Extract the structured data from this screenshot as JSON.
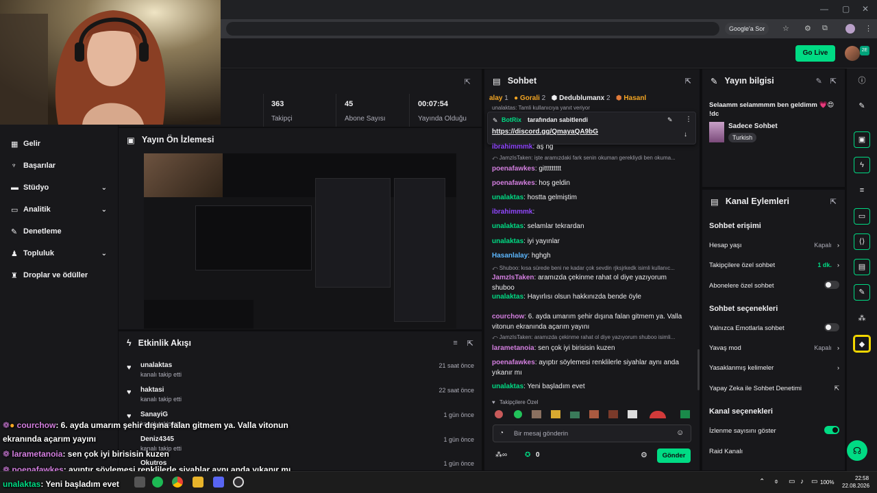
{
  "browser": {
    "google_sor": "Google'a Sor"
  },
  "topnav": {
    "go_live": "Go Live",
    "badge": "2E"
  },
  "leftnav": {
    "items": [
      {
        "label": "Gelir"
      },
      {
        "label": "Başarılar"
      },
      {
        "label": "Stüdyo"
      },
      {
        "label": "Analitik"
      },
      {
        "label": "Denetleme"
      },
      {
        "label": "Topluluk"
      },
      {
        "label": "Droplar ve ödüller"
      }
    ]
  },
  "stats": [
    {
      "value": "363",
      "label": "Takipçi"
    },
    {
      "value": "45",
      "label": "Abone Sayısı"
    },
    {
      "value": "00:07:54",
      "label": "Yayında Olduğu Süre"
    }
  ],
  "preview": {
    "title": "Yayın Ön İzlemesi"
  },
  "activity": {
    "title": "Etkinlik Akışı",
    "items": [
      {
        "name": "unalaktas",
        "sub": "kanalı takip etti",
        "time": "21 saat önce"
      },
      {
        "name": "haktasi",
        "sub": "kanalı takip etti",
        "time": "22 saat önce"
      },
      {
        "name": "SanayiG",
        "sub": "kanalı takip etti",
        "time": "1 gün önce"
      },
      {
        "name": "Deniz4345",
        "sub": "kanalı takip etti",
        "time": "1 gün önce"
      },
      {
        "name": "Okutros",
        "sub": "",
        "time": "1 gün önce"
      }
    ]
  },
  "chat": {
    "title": "Sohbet",
    "tabs": [
      {
        "name": "alay",
        "count": "1"
      },
      {
        "name": "Gorali",
        "count": "2"
      },
      {
        "name": "Dedublumanx",
        "count": "2"
      },
      {
        "name": "Hasanl",
        "count": ""
      }
    ],
    "top_reply": "unalaktas: Tamli kullanıcıya yanıt veriyor",
    "pinned_by": "BotRix",
    "pinned_suffix": "tarafından sabitlendi",
    "pinned_link": "https://discord.gg/QmayaQA9bG",
    "messages": [
      {
        "user": "ibrahimmmk",
        "text": ": aş ng",
        "color": "#9147ff"
      },
      {
        "reply": "JamzIsTaken: işte aramızdaki fark senin okuman gerekliydi ben okuma..."
      },
      {
        "user": "poenafawkes",
        "text": ": gittttttttt",
        "color": "#d47fe0"
      },
      {
        "user": "poenafawkes",
        "text": ": hoş geldin",
        "color": "#d47fe0"
      },
      {
        "user": "unalaktas",
        "text": ": hostta gelmiştim",
        "color": "#00db84"
      },
      {
        "user": "ibrahimmmk",
        "text": ":",
        "color": "#9147ff"
      },
      {
        "user": "unalaktas",
        "text": ": selamlar tekrardan",
        "color": "#00db84"
      },
      {
        "user": "unalaktas",
        "text": ": iyi yayınlar",
        "color": "#00db84"
      },
      {
        "user": "Hasanlalay",
        "text": ": hghgh",
        "color": "#5cb7ff"
      },
      {
        "reply": "Shuboo: kısa sürede beni ne kadar çok sevdin rjksjrkedk isimli kullanıc..."
      },
      {
        "user": "JamzIsTaken",
        "text": ": aramızda çekinme rahat ol diye yazıyorum shuboo",
        "color": "#d47fe0"
      },
      {
        "user": "unalaktas",
        "text": ": Hayırlısı olsun hakkınızda bende öyle",
        "color": "#00db84"
      },
      {
        "user": "courchow",
        "text": ": 6. ayda umarım şehir dışına falan gitmem ya. Valla vitonun ekranında açarım yayını",
        "color": "#d47fe0"
      },
      {
        "reply": "JamzIsTaken: aramızda çekinme rahat ol diye yazıyorum shuboo isimli..."
      },
      {
        "user": "larametanoia",
        "text": ": sen çok iyi birisisin kuzen",
        "color": "#d47fe0"
      },
      {
        "user": "poenafawkes",
        "text": ": ayıptır söylemesi renklilerle siyahlar aynı anda yıkanır mı",
        "color": "#d47fe0"
      },
      {
        "user": "unalaktas",
        "text": ": Yeni başladım evet",
        "color": "#00db84"
      }
    ],
    "followers_only": "Takipçilere Özel",
    "input_placeholder": "Bir mesaj gönderin",
    "points": "0",
    "send": "Gönder"
  },
  "info": {
    "title": "Yayın bilgisi",
    "stream_title": "Selaamm selammmm ben geldimm 💗😍 !dc",
    "category": "Sadece Sohbet",
    "tag": "Turkish"
  },
  "actions": {
    "title": "Kanal Eylemleri",
    "section1": "Sohbet erişimi",
    "hesap_yasi": "Hesap yaşı",
    "hesap_yasi_val": "Kapalı",
    "takipci": "Takipçilere özel sohbet",
    "takipci_val": "1 dk.",
    "abone": "Abonelere özel sohbet",
    "section2": "Sohbet seçenekleri",
    "emote": "Yalnızca Emotlarla sohbet",
    "yavas": "Yavaş mod",
    "yavas_val": "Kapalı",
    "yasak": "Yasaklanmış kelimeler",
    "yapay": "Yapay Zeka ile Sohbet Denetimi",
    "section3": "Kanal seçenekleri",
    "izlenme": "İzlenme sayısını göster",
    "raid": "Raid Kanalı"
  },
  "overlay": [
    {
      "user": "courchow",
      "text": ": 6. ayda umarım şehir dışına falan gitmem ya. Valla vitonun",
      "color": "#d47fe0"
    },
    {
      "user": "",
      "text": "ekranında açarım yayını",
      "color": "#ffffff"
    },
    {
      "user": "larametanoia",
      "text": ": sen çok iyi birisisin kuzen",
      "color": "#d47fe0"
    },
    {
      "user": "poenafawkes",
      "text": ": ayıptır söylemesi renklilerle siyahlar aynı anda yıkanır mı",
      "color": "#d47fe0"
    },
    {
      "user": "unalaktas",
      "text": ": Yeni başladım evet",
      "color": "#00db84"
    }
  ],
  "taskbar": {
    "battery": "100%",
    "time": "22:58",
    "date": "22.08.2026"
  },
  "colors": {
    "accent": "#00db84",
    "panel": "#18181b",
    "bg": "#0e0e10"
  }
}
